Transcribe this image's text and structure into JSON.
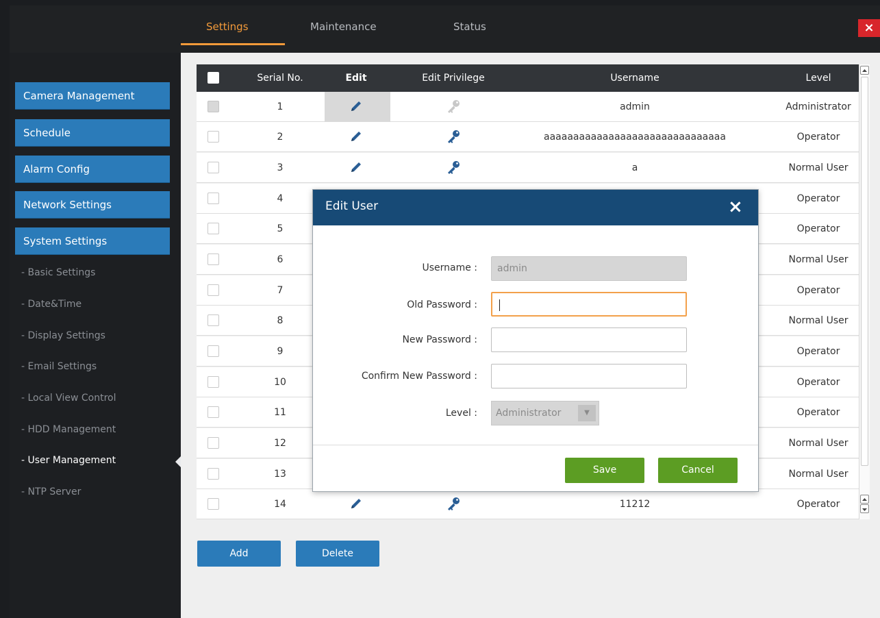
{
  "header": {
    "tabs": [
      {
        "label": "Settings",
        "active": true
      },
      {
        "label": "Maintenance",
        "active": false
      },
      {
        "label": "Status",
        "active": false
      }
    ],
    "close_label": "×"
  },
  "sidebar": {
    "sections": [
      {
        "label": "Camera Management"
      },
      {
        "label": "Schedule"
      },
      {
        "label": "Alarm Config"
      },
      {
        "label": "Network Settings"
      },
      {
        "label": "System Settings"
      }
    ],
    "subitems": [
      {
        "label": "- Basic Settings"
      },
      {
        "label": "- Date&Time"
      },
      {
        "label": "- Display Settings"
      },
      {
        "label": "- Email Settings"
      },
      {
        "label": "- Local View Control"
      },
      {
        "label": "- HDD Management"
      },
      {
        "label": "- User Management",
        "active": true
      },
      {
        "label": "- NTP Server"
      }
    ]
  },
  "table": {
    "columns": [
      "Serial No.",
      "Edit",
      "Edit Privilege",
      "Username",
      "Level"
    ],
    "rows": [
      {
        "serial": "1",
        "username": "admin",
        "level": "Administrator"
      },
      {
        "serial": "2",
        "username": "aaaaaaaaaaaaaaaaaaaaaaaaaaaaaaa",
        "level": "Operator"
      },
      {
        "serial": "3",
        "username": "a",
        "level": "Normal User"
      },
      {
        "serial": "4",
        "username": "",
        "level": "Operator"
      },
      {
        "serial": "5",
        "username": "",
        "level": "Operator"
      },
      {
        "serial": "6",
        "username": "",
        "level": "Normal User"
      },
      {
        "serial": "7",
        "username": "",
        "level": "Operator"
      },
      {
        "serial": "8",
        "username": "",
        "level": "Normal User"
      },
      {
        "serial": "9",
        "username": "",
        "level": "Operator"
      },
      {
        "serial": "10",
        "username": "",
        "level": "Operator"
      },
      {
        "serial": "11",
        "username": "",
        "level": "Operator"
      },
      {
        "serial": "12",
        "username": "",
        "level": "Normal User"
      },
      {
        "serial": "13",
        "username": "",
        "level": "Normal User"
      },
      {
        "serial": "14",
        "username": "11212",
        "level": "Operator"
      }
    ]
  },
  "actions": {
    "add_label": "Add",
    "delete_label": "Delete"
  },
  "modal": {
    "title": "Edit User",
    "close_label": "×",
    "username_label": "Username :",
    "username_value": "admin",
    "old_password_label": "Old Password :",
    "new_password_label": "New Password :",
    "confirm_password_label": "Confirm New Password :",
    "level_label": "Level :",
    "level_value": "Administrator",
    "save_label": "Save",
    "cancel_label": "Cancel"
  },
  "colors": {
    "accent_tab": "#f29a3a",
    "sidebar_button": "#2b7bb9",
    "modal_header": "#174a76",
    "save_green": "#5c9d23",
    "close_red": "#d8262b"
  },
  "icons": {
    "edit": "pencil-icon",
    "privilege": "key-icon"
  }
}
